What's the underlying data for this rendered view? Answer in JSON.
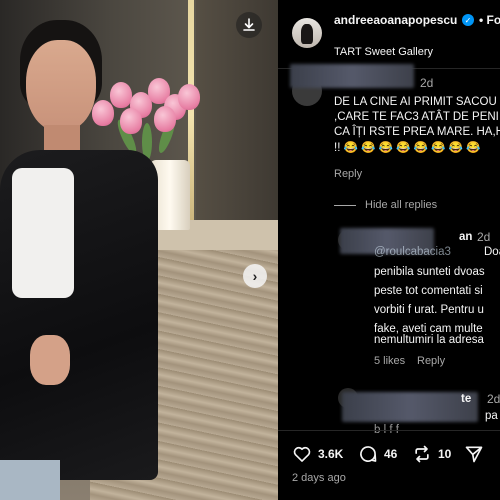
{
  "post": {
    "username": "andreeaoanapopescu",
    "verified": true,
    "location": "TART Sweet Gallery",
    "header_more": "• Fo"
  },
  "comments": [
    {
      "time": "2d",
      "lines": [
        "DE LA CINE AI PRIMIT SACOU",
        ",CARE TE FAC3 ATÂT DE PENI",
        "CA ÎȚI RSTE PREA MARE. HA,H",
        "!! 😂 😂 😂 😂 😂 😂 😂 😂"
      ],
      "reply_label": "Reply",
      "hide_replies_label": "Hide all replies"
    },
    {
      "username_tail": "an",
      "time": "2d",
      "mention": "@roulcabacia3",
      "first_text": "Doam",
      "lines": [
        "penibila sunteti dvoas",
        "peste tot comentati si",
        "vorbiti f urat. Pentru u",
        "fake, aveti cam multe",
        "nemultumiri la adresa"
      ],
      "likes_label": "5 likes",
      "reply_label": "Reply"
    },
    {
      "username_tail": "te",
      "time": "2d",
      "partial_text": "pa",
      "partial_line2": "b    l    f   f"
    }
  ],
  "actions": {
    "likes": "3.6K",
    "comments": "46",
    "reposts": "10",
    "posted_ago": "2 days ago"
  }
}
